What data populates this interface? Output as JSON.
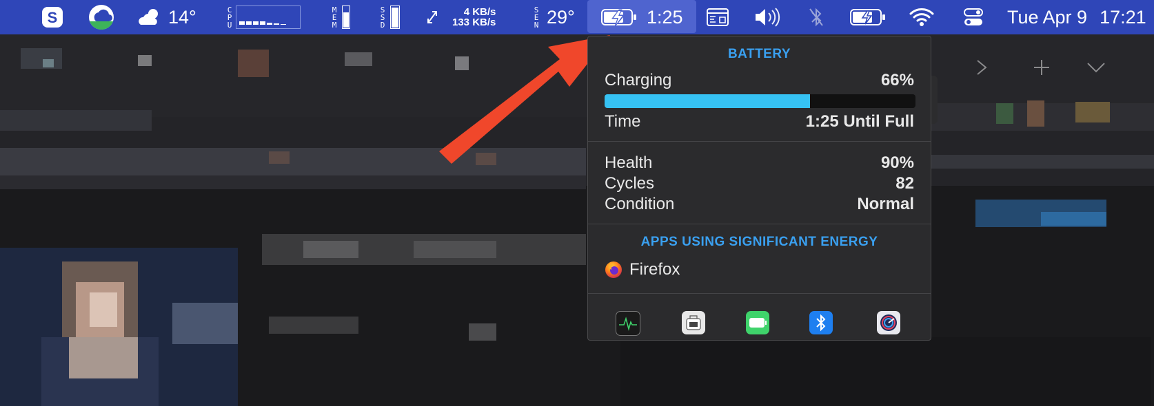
{
  "menubar": {
    "weather_temp": "14°",
    "cpu_label": "CPU",
    "mem_label": "MEM",
    "ssd_label": "SSD",
    "net_up": "4 KB/s",
    "net_down": "133 KB/s",
    "sen_label": "SEN",
    "sensor_temp": "29°",
    "battery_time": "1:25",
    "date": "Tue Apr 9",
    "time": "17:21"
  },
  "popover": {
    "title": "BATTERY",
    "status_label": "Charging",
    "percent": "66%",
    "level": 0.66,
    "time_label": "Time",
    "time_value": "1:25 Until Full",
    "health_label": "Health",
    "health_value": "90%",
    "cycles_label": "Cycles",
    "cycles_value": "82",
    "condition_label": "Condition",
    "condition_value": "Normal",
    "apps_title": "APPS USING SIGNIFICANT ENERGY",
    "apps": [
      {
        "name": "Firefox",
        "icon": "firefox-icon"
      }
    ],
    "footer_icons": [
      "activity-monitor-icon",
      "system-report-icon",
      "battery-settings-icon",
      "bluetooth-icon",
      "disk-utility-icon"
    ]
  },
  "colors": {
    "menubar": "#2f46b8",
    "accent": "#3aa0f0",
    "bar_fill": "#36c2f3",
    "arrow": "#f0472b"
  }
}
